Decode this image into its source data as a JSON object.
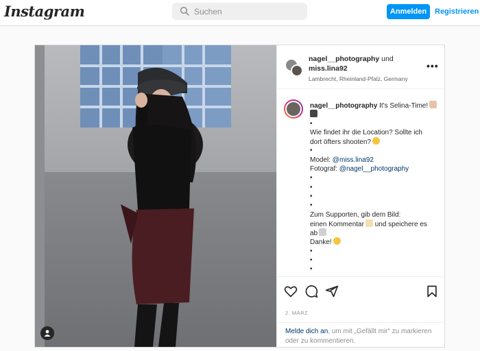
{
  "nav": {
    "logo": "Instagram",
    "search_placeholder": "Suchen",
    "login_label": "Anmelden",
    "register_label": "Registrieren"
  },
  "post": {
    "header": {
      "user1": "nagel__photography",
      "connector": " und",
      "user2": "miss.lina92",
      "location": "Lambrecht, Rheinland-Pfalz, Germany"
    },
    "caption": {
      "author": "nagel__photography",
      "lines": [
        "It's Selina-Time!",
        "•",
        "Wie findet ihr die Location? Sollte ich",
        "dort öfters shooten?",
        "•",
        "Model: ",
        "@miss.lina92",
        "Fotograf: ",
        "@nagel__photography",
        "•",
        "•",
        "•",
        "•",
        "Zum Supporten, gib dem Bild:",
        "einen Kommentar",
        " und speichere es",
        "ab",
        "Danke!",
        "•",
        "•",
        "•"
      ]
    },
    "date": "2. MÄRZ",
    "footer": {
      "login_link": "Melde dich an",
      "text": ", um mit „Gefällt mir“ zu markieren oder zu kommentieren."
    }
  },
  "colors": {
    "accent": "#0095f6",
    "link": "#00376b",
    "muted": "#8e8e8e",
    "border": "#dbdbdb"
  },
  "icons": [
    "search-icon",
    "more-options-icon",
    "heart-icon",
    "comment-icon",
    "share-icon",
    "bookmark-icon",
    "tag-user-icon"
  ]
}
